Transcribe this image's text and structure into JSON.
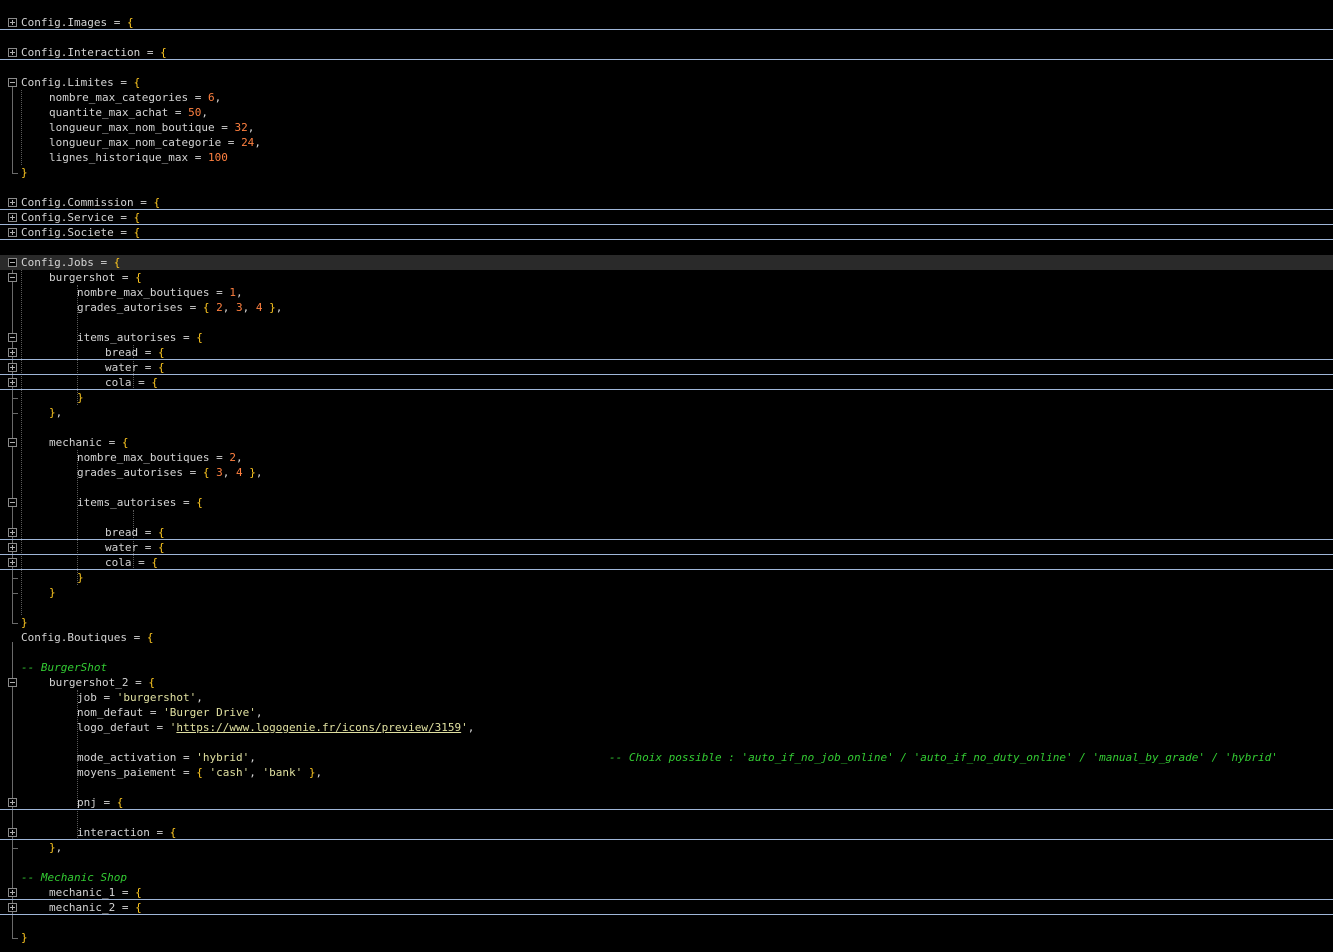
{
  "editor": {
    "colors": {
      "background": "#000000",
      "identifier": "#d4d4d4",
      "bracket": "#ffc820",
      "number": "#ff8040",
      "string": "#e0e0a0",
      "comment": "#33cc33",
      "fold_separator": "#9fb6d8",
      "current_line": "#2a2a2a"
    },
    "lines": [
      {
        "fold": "plus",
        "folded": true,
        "indent": 0,
        "tokens": [
          [
            "id",
            "Config.Images"
          ],
          [
            "op",
            " = "
          ],
          [
            "br",
            "{"
          ]
        ]
      },
      {
        "indent": 0,
        "tokens": []
      },
      {
        "fold": "plus",
        "folded": true,
        "indent": 0,
        "tokens": [
          [
            "id",
            "Config.Interaction"
          ],
          [
            "op",
            " = "
          ],
          [
            "br",
            "{"
          ]
        ]
      },
      {
        "indent": 0,
        "tokens": []
      },
      {
        "fold": "minus",
        "indent": 0,
        "tokens": [
          [
            "id",
            "Config.Limites"
          ],
          [
            "op",
            " = "
          ],
          [
            "br",
            "{"
          ]
        ]
      },
      {
        "indent": 1,
        "tokens": [
          [
            "id",
            "nombre_max_categories"
          ],
          [
            "op",
            " = "
          ],
          [
            "num",
            "6"
          ],
          [
            "pn",
            ","
          ]
        ]
      },
      {
        "indent": 1,
        "tokens": [
          [
            "id",
            "quantite_max_achat"
          ],
          [
            "op",
            " = "
          ],
          [
            "num",
            "50"
          ],
          [
            "pn",
            ","
          ]
        ]
      },
      {
        "indent": 1,
        "tokens": [
          [
            "id",
            "longueur_max_nom_boutique"
          ],
          [
            "op",
            " = "
          ],
          [
            "num",
            "32"
          ],
          [
            "pn",
            ","
          ]
        ]
      },
      {
        "indent": 1,
        "tokens": [
          [
            "id",
            "longueur_max_nom_categorie"
          ],
          [
            "op",
            " = "
          ],
          [
            "num",
            "24"
          ],
          [
            "pn",
            ","
          ]
        ]
      },
      {
        "indent": 1,
        "tokens": [
          [
            "id",
            "lignes_historique_max"
          ],
          [
            "op",
            " = "
          ],
          [
            "num",
            "100"
          ]
        ]
      },
      {
        "indent": 0,
        "tokens": [
          [
            "br",
            "}"
          ]
        ]
      },
      {
        "indent": 0,
        "tokens": []
      },
      {
        "fold": "plus",
        "folded": true,
        "indent": 0,
        "tokens": [
          [
            "id",
            "Config.Commission"
          ],
          [
            "op",
            " = "
          ],
          [
            "br",
            "{"
          ]
        ]
      },
      {
        "fold": "plus",
        "folded": true,
        "indent": 0,
        "tokens": [
          [
            "id",
            "Config.Service"
          ],
          [
            "op",
            " = "
          ],
          [
            "br",
            "{"
          ]
        ]
      },
      {
        "fold": "plus",
        "folded": true,
        "indent": 0,
        "tokens": [
          [
            "id",
            "Config.Societe"
          ],
          [
            "op",
            " = "
          ],
          [
            "br",
            "{"
          ]
        ]
      },
      {
        "indent": 0,
        "tokens": []
      },
      {
        "fold": "minus",
        "current": true,
        "indent": 0,
        "tokens": [
          [
            "id",
            "Config.Jobs"
          ],
          [
            "op",
            " = "
          ],
          [
            "br",
            "{"
          ]
        ]
      },
      {
        "fold": "minus",
        "indent": 1,
        "tokens": [
          [
            "id",
            "burgershot"
          ],
          [
            "op",
            " = "
          ],
          [
            "br",
            "{"
          ]
        ]
      },
      {
        "indent": 2,
        "tokens": [
          [
            "id",
            "nombre_max_boutiques"
          ],
          [
            "op",
            " = "
          ],
          [
            "num",
            "1"
          ],
          [
            "pn",
            ","
          ]
        ]
      },
      {
        "indent": 2,
        "tokens": [
          [
            "id",
            "grades_autorises"
          ],
          [
            "op",
            " = "
          ],
          [
            "br",
            "{"
          ],
          [
            "op",
            " "
          ],
          [
            "num",
            "2"
          ],
          [
            "pn",
            ", "
          ],
          [
            "num",
            "3"
          ],
          [
            "pn",
            ", "
          ],
          [
            "num",
            "4"
          ],
          [
            "op",
            " "
          ],
          [
            "br",
            "}"
          ],
          [
            "pn",
            ","
          ]
        ]
      },
      {
        "indent": 0,
        "tokens": []
      },
      {
        "fold": "minus",
        "indent": 2,
        "tokens": [
          [
            "id",
            "items_autorises"
          ],
          [
            "op",
            " = "
          ],
          [
            "br",
            "{"
          ]
        ]
      },
      {
        "fold": "plus",
        "folded": true,
        "indent": 3,
        "tokens": [
          [
            "id",
            "bread"
          ],
          [
            "op",
            " = "
          ],
          [
            "br",
            "{"
          ]
        ]
      },
      {
        "fold": "plus",
        "folded": true,
        "indent": 3,
        "tokens": [
          [
            "id",
            "water"
          ],
          [
            "op",
            " = "
          ],
          [
            "br",
            "{"
          ]
        ]
      },
      {
        "fold": "plus",
        "folded": true,
        "indent": 3,
        "tokens": [
          [
            "id",
            "cola"
          ],
          [
            "op",
            " = "
          ],
          [
            "br",
            "{"
          ]
        ]
      },
      {
        "indent": 2,
        "tokens": [
          [
            "br",
            "}"
          ]
        ]
      },
      {
        "indent": 1,
        "tokens": [
          [
            "br",
            "}"
          ],
          [
            "pn",
            ","
          ]
        ]
      },
      {
        "indent": 0,
        "tokens": []
      },
      {
        "fold": "minus",
        "indent": 1,
        "tokens": [
          [
            "id",
            "mechanic"
          ],
          [
            "op",
            " = "
          ],
          [
            "br",
            "{"
          ]
        ]
      },
      {
        "indent": 2,
        "tokens": [
          [
            "id",
            "nombre_max_boutiques"
          ],
          [
            "op",
            " = "
          ],
          [
            "num",
            "2"
          ],
          [
            "pn",
            ","
          ]
        ]
      },
      {
        "indent": 2,
        "tokens": [
          [
            "id",
            "grades_autorises"
          ],
          [
            "op",
            " = "
          ],
          [
            "br",
            "{"
          ],
          [
            "op",
            " "
          ],
          [
            "num",
            "3"
          ],
          [
            "pn",
            ", "
          ],
          [
            "num",
            "4"
          ],
          [
            "op",
            " "
          ],
          [
            "br",
            "}"
          ],
          [
            "pn",
            ","
          ]
        ]
      },
      {
        "indent": 0,
        "tokens": []
      },
      {
        "fold": "minus",
        "indent": 2,
        "tokens": [
          [
            "id",
            "items_autorises"
          ],
          [
            "op",
            " = "
          ],
          [
            "br",
            "{"
          ]
        ]
      },
      {
        "indent": 0,
        "tokens": []
      },
      {
        "fold": "plus",
        "folded": true,
        "indent": 3,
        "tokens": [
          [
            "id",
            "bread"
          ],
          [
            "op",
            " = "
          ],
          [
            "br",
            "{"
          ]
        ]
      },
      {
        "fold": "plus",
        "folded": true,
        "indent": 3,
        "tokens": [
          [
            "id",
            "water"
          ],
          [
            "op",
            " = "
          ],
          [
            "br",
            "{"
          ]
        ]
      },
      {
        "fold": "plus",
        "folded": true,
        "indent": 3,
        "tokens": [
          [
            "id",
            "cola"
          ],
          [
            "op",
            " = "
          ],
          [
            "br",
            "{"
          ]
        ]
      },
      {
        "indent": 2,
        "tokens": [
          [
            "br",
            "}"
          ]
        ]
      },
      {
        "indent": 1,
        "tokens": [
          [
            "br",
            "}"
          ]
        ]
      },
      {
        "indent": 0,
        "tokens": []
      },
      {
        "indent": 0,
        "tokens": [
          [
            "br",
            "}"
          ]
        ]
      },
      {
        "indent": 0,
        "tokens": [
          [
            "id",
            "Config.Boutiques"
          ],
          [
            "op",
            " = "
          ],
          [
            "br",
            "{"
          ]
        ]
      },
      {
        "indent": 0,
        "tokens": []
      },
      {
        "indent": 0,
        "tokens": [
          [
            "com",
            "-- BurgerShot"
          ]
        ]
      },
      {
        "fold": "minus",
        "indent": 1,
        "tokens": [
          [
            "id",
            "burgershot_2"
          ],
          [
            "op",
            " = "
          ],
          [
            "br",
            "{"
          ]
        ]
      },
      {
        "indent": 2,
        "tokens": [
          [
            "id",
            "job"
          ],
          [
            "op",
            " = "
          ],
          [
            "str",
            "'burgershot'"
          ],
          [
            "pn",
            ","
          ]
        ]
      },
      {
        "indent": 2,
        "tokens": [
          [
            "id",
            "nom_defaut"
          ],
          [
            "op",
            " = "
          ],
          [
            "str",
            "'Burger Drive'"
          ],
          [
            "pn",
            ","
          ]
        ]
      },
      {
        "indent": 2,
        "tokens": [
          [
            "id",
            "logo_defaut"
          ],
          [
            "op",
            " = "
          ],
          [
            "str",
            "'"
          ],
          [
            "url",
            "https://www.logogenie.fr/icons/preview/3159"
          ],
          [
            "str",
            "'"
          ],
          [
            "pn",
            ","
          ]
        ]
      },
      {
        "indent": 0,
        "tokens": []
      },
      {
        "indent": 2,
        "tokens": [
          [
            "id",
            "mode_activation"
          ],
          [
            "op",
            " = "
          ],
          [
            "str",
            "'hybrid'"
          ],
          [
            "pn",
            ","
          ]
        ],
        "comment": "-- Choix possible : 'auto_if_no_job_online' / 'auto_if_no_duty_online' / 'manual_by_grade' / 'hybrid'"
      },
      {
        "indent": 2,
        "tokens": [
          [
            "id",
            "moyens_paiement"
          ],
          [
            "op",
            " = "
          ],
          [
            "br",
            "{"
          ],
          [
            "op",
            " "
          ],
          [
            "str",
            "'cash'"
          ],
          [
            "pn",
            ", "
          ],
          [
            "str",
            "'bank'"
          ],
          [
            "op",
            " "
          ],
          [
            "br",
            "}"
          ],
          [
            "pn",
            ","
          ]
        ]
      },
      {
        "indent": 0,
        "tokens": []
      },
      {
        "fold": "plus",
        "folded": true,
        "indent": 2,
        "tokens": [
          [
            "id",
            "pnj"
          ],
          [
            "op",
            " = "
          ],
          [
            "br",
            "{"
          ]
        ]
      },
      {
        "indent": 0,
        "tokens": []
      },
      {
        "fold": "plus",
        "folded": true,
        "indent": 2,
        "tokens": [
          [
            "id",
            "interaction"
          ],
          [
            "op",
            " = "
          ],
          [
            "br",
            "{"
          ]
        ]
      },
      {
        "indent": 1,
        "tokens": [
          [
            "br",
            "}"
          ],
          [
            "pn",
            ","
          ]
        ]
      },
      {
        "indent": 0,
        "tokens": []
      },
      {
        "indent": 0,
        "tokens": [
          [
            "com",
            "-- Mechanic Shop"
          ]
        ]
      },
      {
        "fold": "plus",
        "folded": true,
        "indent": 1,
        "tokens": [
          [
            "id",
            "mechanic_1"
          ],
          [
            "op",
            " = "
          ],
          [
            "br",
            "{"
          ]
        ]
      },
      {
        "fold": "plus",
        "folded": true,
        "indent": 1,
        "tokens": [
          [
            "id",
            "mechanic_2"
          ],
          [
            "op",
            " = "
          ],
          [
            "br",
            "{"
          ]
        ]
      },
      {
        "indent": 0,
        "tokens": []
      },
      {
        "indent": 0,
        "tokens": [
          [
            "br",
            "}"
          ]
        ]
      }
    ]
  }
}
